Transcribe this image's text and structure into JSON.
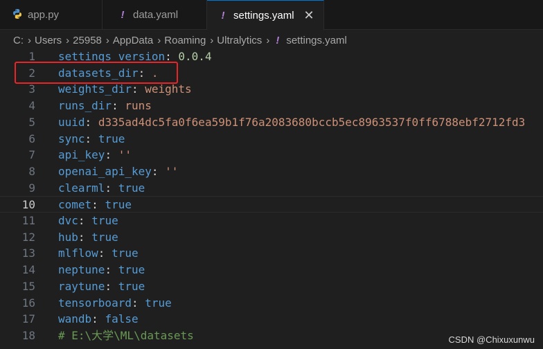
{
  "tabs": [
    {
      "label": "app.py",
      "icon": "python-icon",
      "active": false
    },
    {
      "label": "data.yaml",
      "icon": "yaml-icon",
      "active": false
    },
    {
      "label": "settings.yaml",
      "icon": "yaml-icon",
      "active": true
    }
  ],
  "tab_glyphs": {
    "yaml": "!",
    "close": "✕",
    "chevron": "›"
  },
  "breadcrumb": [
    "C:",
    "Users",
    "25958",
    "AppData",
    "Roaming",
    "Ultralytics",
    "settings.yaml"
  ],
  "lines": [
    {
      "n": "1",
      "key": "settings_version",
      "colon": ":",
      "value": "0.0.4",
      "vtype": "n"
    },
    {
      "n": "2",
      "key": "datasets_dir",
      "colon": ":",
      "value": ".",
      "vtype": "s"
    },
    {
      "n": "3",
      "key": "weights_dir",
      "colon": ":",
      "value": "weights",
      "vtype": "s"
    },
    {
      "n": "4",
      "key": "runs_dir",
      "colon": ":",
      "value": "runs",
      "vtype": "s"
    },
    {
      "n": "5",
      "key": "uuid",
      "colon": ":",
      "value": "d335ad4dc5fa0f6ea59b1f76a2083680bccb5ec8963537f0ff6788ebf2712fd3",
      "vtype": "s"
    },
    {
      "n": "6",
      "key": "sync",
      "colon": ":",
      "value": "true",
      "vtype": "k"
    },
    {
      "n": "7",
      "key": "api_key",
      "colon": ":",
      "value": "''",
      "vtype": "s"
    },
    {
      "n": "8",
      "key": "openai_api_key",
      "colon": ":",
      "value": "''",
      "vtype": "s"
    },
    {
      "n": "9",
      "key": "clearml",
      "colon": ":",
      "value": "true",
      "vtype": "k"
    },
    {
      "n": "10",
      "key": "comet",
      "colon": ":",
      "value": "true",
      "vtype": "k"
    },
    {
      "n": "11",
      "key": "dvc",
      "colon": ":",
      "value": "true",
      "vtype": "k"
    },
    {
      "n": "12",
      "key": "hub",
      "colon": ":",
      "value": "true",
      "vtype": "k"
    },
    {
      "n": "13",
      "key": "mlflow",
      "colon": ":",
      "value": "true",
      "vtype": "k"
    },
    {
      "n": "14",
      "key": "neptune",
      "colon": ":",
      "value": "true",
      "vtype": "k"
    },
    {
      "n": "15",
      "key": "raytune",
      "colon": ":",
      "value": "true",
      "vtype": "k"
    },
    {
      "n": "16",
      "key": "tensorboard",
      "colon": ":",
      "value": "true",
      "vtype": "k"
    },
    {
      "n": "17",
      "key": "wandb",
      "colon": ":",
      "value": "false",
      "vtype": "k"
    },
    {
      "n": "18",
      "comment": "# E:\\大学\\ML\\datasets"
    }
  ],
  "current_line": "10",
  "colors": {
    "accent": "#0078d4",
    "highlight_box": "#e8262a",
    "yaml_icon": "#b180d7"
  },
  "watermark": "CSDN @Chixuxunwu"
}
